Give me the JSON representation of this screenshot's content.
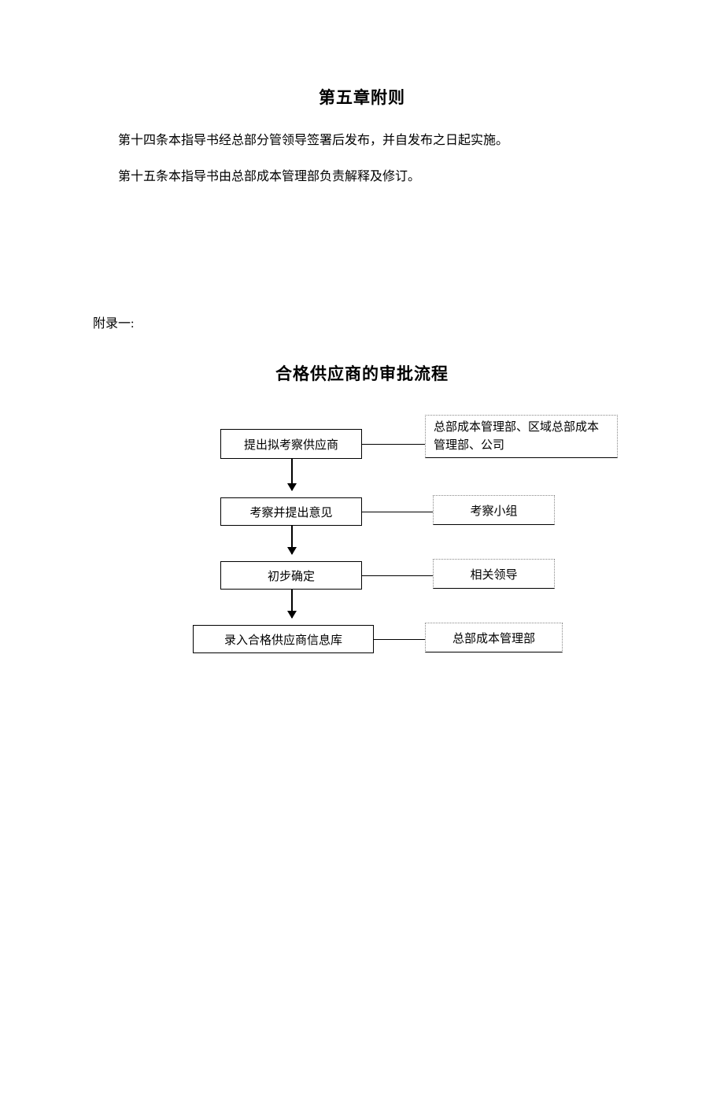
{
  "chapter_title": "第五章附则",
  "paragraph1": "第十四条本指导书经总部分管领导签署后发布，并自发布之日起实施。",
  "paragraph2": "第十五条本指导书由总部成本管理部负责解释及修订。",
  "appendix_label": "附录一:",
  "flowchart_title": "合格供应商的审批流程",
  "flowchart": {
    "steps": [
      {
        "action": "提出拟考察供应商",
        "actor": "总部成本管理部、区域总部成本管理部、公司"
      },
      {
        "action": "考察并提出意见",
        "actor": "考察小组"
      },
      {
        "action": "初步确定",
        "actor": "相关领导"
      },
      {
        "action": "录入合格供应商信息库",
        "actor": "总部成本管理部"
      }
    ]
  }
}
